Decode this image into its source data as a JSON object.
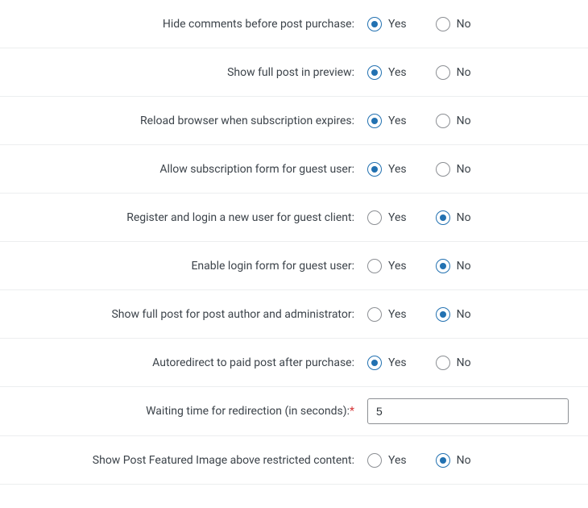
{
  "options": {
    "yes": "Yes",
    "no": "No"
  },
  "rows": [
    {
      "key": "hide-comments",
      "label": "Hide comments before post purchase:",
      "type": "radio",
      "value": "yes"
    },
    {
      "key": "show-full-preview",
      "label": "Show full post in preview:",
      "type": "radio",
      "value": "yes"
    },
    {
      "key": "reload-browser",
      "label": "Reload browser when subscription expires:",
      "type": "radio",
      "value": "yes"
    },
    {
      "key": "allow-sub-guest",
      "label": "Allow subscription form for guest user:",
      "type": "radio",
      "value": "yes"
    },
    {
      "key": "register-guest",
      "label": "Register and login a new user for guest client:",
      "type": "radio",
      "value": "no"
    },
    {
      "key": "enable-login-guest",
      "label": "Enable login form for guest user:",
      "type": "radio",
      "value": "no"
    },
    {
      "key": "full-post-author",
      "label": "Show full post for post author and administrator:",
      "type": "radio",
      "value": "no"
    },
    {
      "key": "autoredirect",
      "label": "Autoredirect to paid post after purchase:",
      "type": "radio",
      "value": "yes"
    },
    {
      "key": "waiting-time",
      "label": "Waiting time for redirection (in seconds):",
      "type": "text",
      "value": "5",
      "required": true
    },
    {
      "key": "featured-image",
      "label": "Show Post Featured Image above restricted content:",
      "type": "radio",
      "value": "no"
    }
  ]
}
